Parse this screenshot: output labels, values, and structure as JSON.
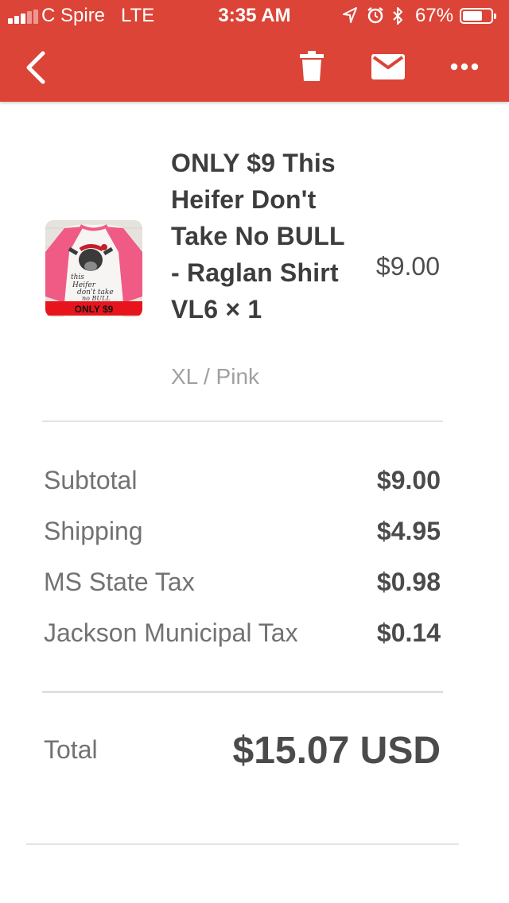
{
  "status_bar": {
    "carrier": "C Spire",
    "network": "LTE",
    "time": "3:35 AM",
    "battery": "67%",
    "battery_level": 0.67
  },
  "app_bar": {
    "color": "#db4437",
    "icons": [
      "back-arrow-icon",
      "trash-icon",
      "mail-icon",
      "more-icon"
    ]
  },
  "item": {
    "title": "ONLY $9 This Heifer Don't Take No BULL - Raglan Shirt VL6 × 1",
    "variant": "XL / Pink",
    "price": "$9.00",
    "image_caption": "ONLY $9",
    "image_text": "this Heifer don't take no BULL"
  },
  "summary": {
    "subtotal_label": "Subtotal",
    "subtotal_value": "$9.00",
    "shipping_label": "Shipping",
    "shipping_value": "$4.95",
    "state_tax_label": "MS State Tax",
    "state_tax_value": "$0.98",
    "municipal_tax_label": "Jackson Municipal Tax",
    "municipal_tax_value": "$0.14",
    "total_label": "Total",
    "total_value": "$15.07 USD"
  }
}
